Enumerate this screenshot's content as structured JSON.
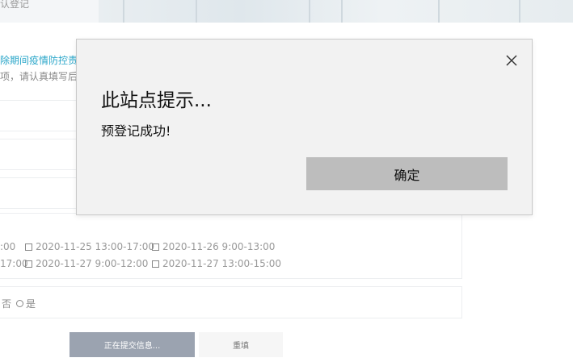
{
  "banner": {
    "title": "认登记"
  },
  "notice": {
    "link_text": "除期间疫情防控责",
    "sub_text": "项，请认真填写后"
  },
  "options": [
    {
      "id": "opt1",
      "label": ":00"
    },
    {
      "id": "opt2",
      "label": "2020-11-25 13:00-17:00"
    },
    {
      "id": "opt3",
      "label": "2020-11-26 9:00-13:00"
    },
    {
      "id": "opt4",
      "label": "17:00"
    },
    {
      "id": "opt5",
      "label": "2020-11-27 9:00-12:00"
    },
    {
      "id": "opt6",
      "label": "2020-11-27 13:00-15:00"
    }
  ],
  "radio": {
    "no_label": "否",
    "yes_label": "是"
  },
  "buttons": {
    "submit_label": "正在提交信息...",
    "reset_label": "重填"
  },
  "dialog": {
    "title": "此站点提示...",
    "message": "预登记成功!",
    "ok_label": "确定"
  }
}
